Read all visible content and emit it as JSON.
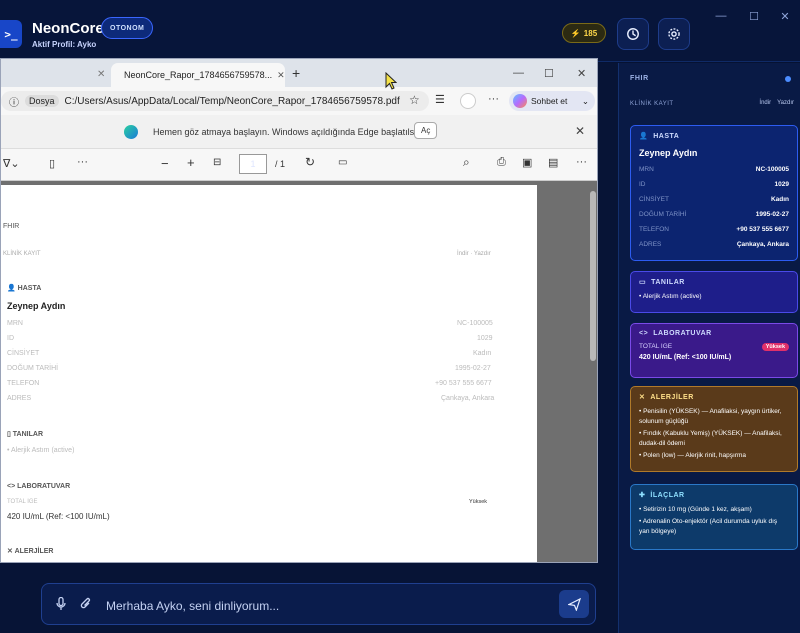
{
  "app": {
    "logo_glyph": ">_",
    "title": "NeonCore",
    "badge": "OTONOM",
    "subtitle": "Aktif Profil: Ayko",
    "credits": "185",
    "window_controls": [
      "—",
      "☐",
      "✕"
    ]
  },
  "browser": {
    "tab_active_title": "NeonCore_Rapor_1784656759578...",
    "address_label": "Dosya",
    "url": "C:/Users/Asus/AppData/Local/Temp/NeonCore_Rapor_1784656759578.pdf",
    "copilot_label": "Sohbet et",
    "infobar_text": "Hemen göz atmaya başlayın. Windows açıldığında Edge başlatılsın.",
    "infobar_button": "Aç",
    "page_current": "1",
    "page_total": "/ 1"
  },
  "pdf": {
    "fhir_label": "FHIR",
    "klinik_label": "KLİNİK KAYIT",
    "actions": "İndir · Yazdır",
    "hasta_heading": "HASTA",
    "patient_name": "Zeynep Aydın",
    "fields": [
      {
        "label": "MRN",
        "value": "NC-100005"
      },
      {
        "label": "ID",
        "value": "1029"
      },
      {
        "label": "CİNSİYET",
        "value": "Kadın"
      },
      {
        "label": "DOĞUM TARİHİ",
        "value": "1995-02-27"
      },
      {
        "label": "TELEFON",
        "value": "+90 537 555 6677"
      },
      {
        "label": "ADRES",
        "value": "Çankaya, Ankara"
      }
    ],
    "tanilar_heading": "TANILAR",
    "tanilar_item": "• Alerjik Astım (active)",
    "lab_heading": "LABORATUVAR",
    "lab_label": "TOTAL IGE",
    "lab_flag": "Yüksek",
    "lab_value": "420 IU/mL (Ref: <100 IU/mL)",
    "alerji_heading": "ALERJİLER"
  },
  "panel": {
    "title": "FHIR",
    "subtitle": "KLİNİK KAYIT",
    "download": "İndir",
    "print": "Yazdır",
    "hasta": {
      "heading": "HASTA",
      "name": "Zeynep Aydın",
      "rows": [
        {
          "k": "MRN",
          "v": "NC-100005"
        },
        {
          "k": "ID",
          "v": "1029"
        },
        {
          "k": "CİNSİYET",
          "v": "Kadın"
        },
        {
          "k": "DOĞUM TARİHİ",
          "v": "1995-02-27"
        },
        {
          "k": "TELEFON",
          "v": "+90 537 555 6677"
        },
        {
          "k": "ADRES",
          "v": "Çankaya, Ankara"
        }
      ]
    },
    "tanilar": {
      "heading": "TANILAR",
      "item": "• Alerjik Astım (active)"
    },
    "lab": {
      "heading": "LABORATUVAR",
      "label": "TOTAL IGE",
      "flag": "Yüksek",
      "value": "420 IU/mL (Ref: <100 IU/mL)"
    },
    "alerjiler": {
      "heading": "ALERJİLER",
      "items": [
        "• Penisilin (YÜKSEK) — Anafilaksi, yaygın ürtiker, solunum güçlüğü",
        "• Fındık (Kabuklu Yemiş) (YÜKSEK) — Anafilaksi, dudak-dil ödemi",
        "• Polen (low) — Alerjik rinit, hapşırma"
      ]
    },
    "ilaclar": {
      "heading": "İLAÇLAR",
      "items": [
        "• Setirizin 10 mg (Günde 1 kez, akşam)",
        "• Adrenalin Oto-enjektör (Acil durumda uyluk dış yan bölgeye)"
      ]
    }
  },
  "chat": {
    "input_value": "Merhaba Ayko, seni dinliyorum..."
  },
  "colors": {
    "background": "#061232",
    "accent": "#3a66ff",
    "warning": "#ffd84a",
    "danger_badge": "#e0306a"
  }
}
